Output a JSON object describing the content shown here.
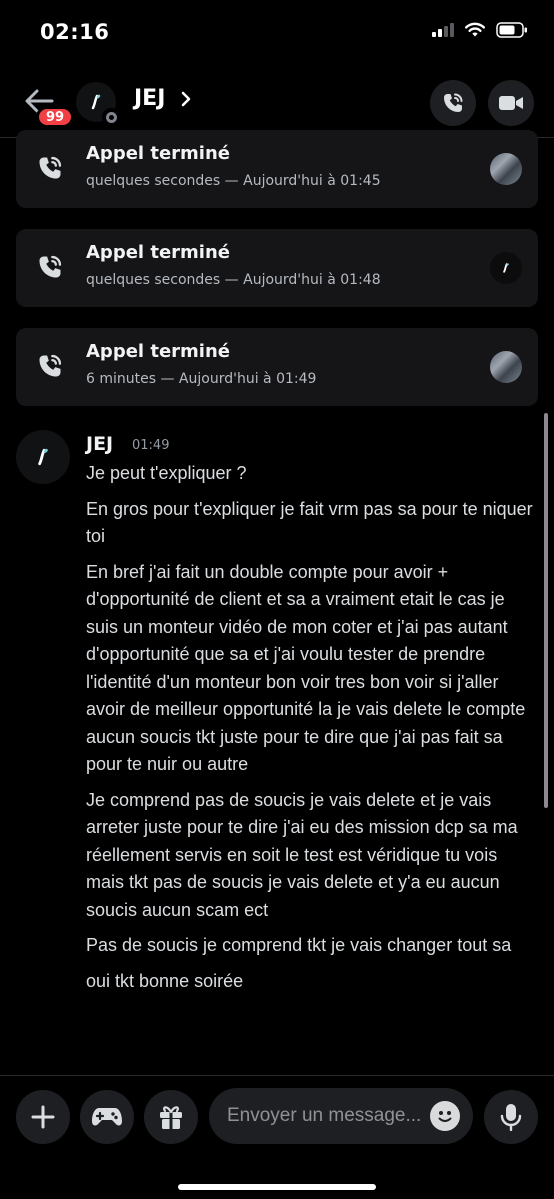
{
  "status_bar": {
    "time": "02:16"
  },
  "header": {
    "title": "JEJ",
    "unread_count": "99",
    "avatar_icon": "jej-logo",
    "buttons": [
      "voice-call-icon",
      "video-call-icon"
    ]
  },
  "calls": [
    {
      "title": "Appel terminé",
      "subtitle": "quelques secondes — Aujourd'hui à 01:45",
      "avatar": "photo"
    },
    {
      "title": "Appel terminé",
      "subtitle": "quelques secondes — Aujourd'hui à 01:48",
      "avatar": "logo"
    },
    {
      "title": "Appel terminé",
      "subtitle": "6 minutes — Aujourd'hui à 01:49",
      "avatar": "photo"
    }
  ],
  "message": {
    "author": "JEJ",
    "time": "01:49",
    "lines": [
      "Je peut t'expliquer ?",
      "En gros pour t'expliquer je fait vrm pas sa pour te niquer toi",
      "En bref j'ai fait un double compte pour avoir + d'opportunité de client et sa a vraiment etait le cas je suis un monteur vidéo de mon coter et j'ai pas autant d'opportunité que sa et j'ai voulu tester de prendre l'identité d'un monteur bon voir tres bon voir si j'aller avoir de meilleur opportunité la je vais delete le compte aucun soucis tkt juste pour te dire que j'ai pas fait sa pour te nuir ou autre",
      "Je comprend pas de soucis je vais delete et je vais arreter juste pour te dire j'ai eu des mission dcp sa ma réellement servis en soit le test est véridique tu vois mais tkt pas de soucis je vais delete et y'a eu aucun soucis aucun scam ect",
      "Pas de soucis je comprend tkt je vais changer tout sa",
      "oui tkt bonne soirée"
    ]
  },
  "composer": {
    "placeholder": "Envoyer un message...",
    "buttons": [
      "plus-icon",
      "gamepad-icon",
      "gift-icon",
      "emoji-icon",
      "microphone-icon"
    ]
  }
}
